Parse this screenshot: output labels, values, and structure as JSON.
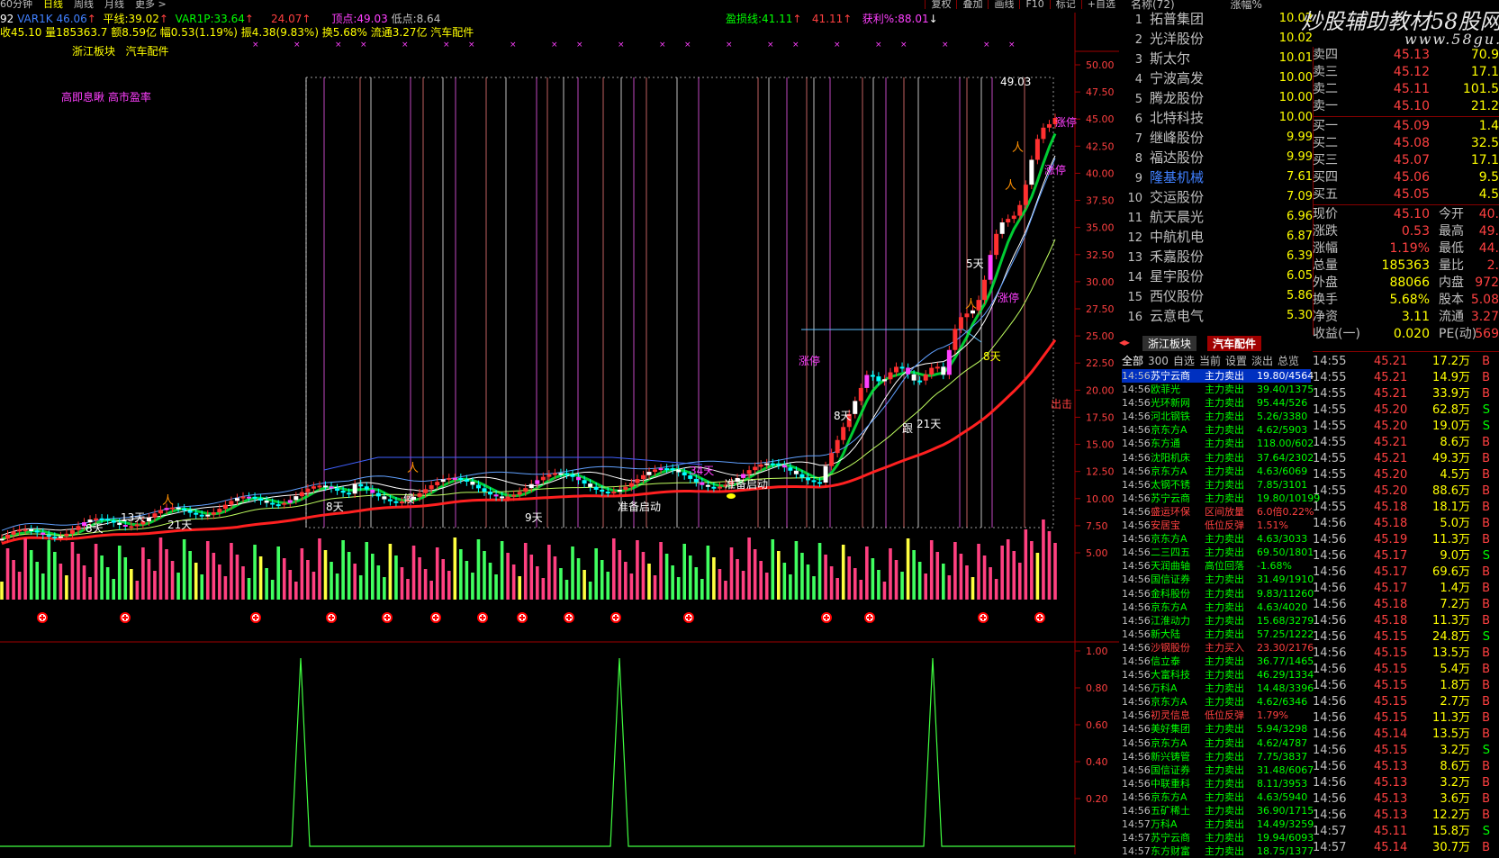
{
  "topbar": {
    "periods": [
      "60分钟",
      "日线",
      "周线",
      "月线",
      "更多 >"
    ],
    "tools": [
      "复权",
      "叠加",
      "画线",
      "F10",
      "标记",
      "+自选"
    ]
  },
  "indicator_row1": {
    "a": "92",
    "var1k_label": "VAR1K",
    "var1k": "46.06",
    "pingxian_label": "平线:",
    "pingxian": "39.02",
    "var1p_label": "VAR1P:",
    "var1p": "33.64",
    "v24": "24.07",
    "dingdian_label": "顶点:",
    "dingdian": "49.03",
    "didian_label": "低点:",
    "didian": "8.64",
    "yingsunxian_label": "盈损线:",
    "yingsunxian": "41.11",
    "v41": "41.11",
    "huoli_label": "获利%:",
    "huoli": "88.01"
  },
  "indicator_row2": "收45.10 量185363.7 额8.59亿 幅0.53(1.19%) 振4.38(9.83%) 换5.68% 流通3.27亿 汽车配件",
  "sector_tags": [
    "浙江板块",
    "汽车配件"
  ],
  "chart_note": "高即息瞅 高市盈率",
  "chart_labels": {
    "peak": "49.03",
    "zhangting": "涨停",
    "chuji": "出击",
    "zhunbei": "准备启动",
    "zhunbei2": "准备启动",
    "d8": "8天",
    "d21": "21天",
    "d5": "5天",
    "d9": "9天",
    "d13": "13天",
    "d34": "34天",
    "gen": "跟",
    "hou": "候"
  },
  "price_axis": [
    "50.00",
    "47.50",
    "45.00",
    "42.50",
    "40.00",
    "37.50",
    "35.00",
    "32.50",
    "30.00",
    "27.50",
    "25.00",
    "22.50",
    "20.00",
    "17.50",
    "15.00",
    "12.50",
    "10.00",
    "7.50",
    "5.00"
  ],
  "sub_axis": [
    "1.00",
    "0.80",
    "0.60",
    "0.40",
    "0.20"
  ],
  "stocklist": {
    "header_name": "名称(72)",
    "header_pct": "涨幅%",
    "items": [
      {
        "n": "1",
        "name": "拓普集团",
        "pct": "10.02"
      },
      {
        "n": "2",
        "name": "光洋股份",
        "pct": "10.02"
      },
      {
        "n": "3",
        "name": "斯太尔",
        "pct": "10.01"
      },
      {
        "n": "4",
        "name": "宁波高发",
        "pct": "10.00"
      },
      {
        "n": "5",
        "name": "腾龙股份",
        "pct": "10.00"
      },
      {
        "n": "6",
        "name": "北特科技",
        "pct": "10.00"
      },
      {
        "n": "7",
        "name": "继峰股份",
        "pct": "9.99"
      },
      {
        "n": "8",
        "name": "福达股份",
        "pct": "9.99"
      },
      {
        "n": "9",
        "name": "隆基机械",
        "pct": "7.61"
      },
      {
        "n": "10",
        "name": "交运股份",
        "pct": "7.09"
      },
      {
        "n": "11",
        "name": "航天晨光",
        "pct": "6.96"
      },
      {
        "n": "12",
        "name": "中航机电",
        "pct": "6.87"
      },
      {
        "n": "13",
        "name": "禾嘉股份",
        "pct": "6.39"
      },
      {
        "n": "14",
        "name": "星宇股份",
        "pct": "6.05"
      },
      {
        "n": "15",
        "name": "西仪股份",
        "pct": "5.86"
      },
      {
        "n": "16",
        "name": "云意电气",
        "pct": "5.30"
      }
    ]
  },
  "watermark": "炒股辅助教材58股网",
  "watermark_url": "www.58gu.com",
  "orderbook": [
    {
      "l": "卖四",
      "p": "45.13",
      "v": "70.9"
    },
    {
      "l": "卖三",
      "p": "45.12",
      "v": "17.1"
    },
    {
      "l": "卖二",
      "p": "45.11",
      "v": "101.5"
    },
    {
      "l": "卖一",
      "p": "45.10",
      "v": "21.2"
    },
    {
      "l": "买一",
      "p": "45.09",
      "v": "1.4"
    },
    {
      "l": "买二",
      "p": "45.08",
      "v": "32.5"
    },
    {
      "l": "买三",
      "p": "45.07",
      "v": "17.1"
    },
    {
      "l": "买四",
      "p": "45.06",
      "v": "9.5"
    },
    {
      "l": "买五",
      "p": "45.05",
      "v": "4.5"
    }
  ],
  "stats": [
    {
      "l": "现价",
      "v": "45.10",
      "l2": "今开",
      "v2": "40."
    },
    {
      "l": "涨跌",
      "v": "0.53",
      "l2": "最高",
      "v2": "49."
    },
    {
      "l": "涨幅",
      "v": "1.19%",
      "l2": "最低",
      "v2": "44."
    },
    {
      "l": "总量",
      "v": "185363",
      "l2": "量比",
      "v2": "2."
    },
    {
      "l": "外盘",
      "v": "88066",
      "l2": "内盘",
      "v2": "972"
    },
    {
      "l": "换手",
      "v": "5.68%",
      "l2": "股本",
      "v2": "5.08"
    },
    {
      "l": "净资",
      "v": "3.11",
      "l2": "流通",
      "v2": "3.27"
    },
    {
      "l": "收益(一)",
      "v": "0.020",
      "l2": "PE(动)",
      "v2": "569"
    }
  ],
  "tabs": [
    "浙江板块",
    "汽车配件"
  ],
  "subtabs": [
    "全部",
    "300",
    "自选",
    "当前",
    "设置",
    "淡出",
    "总览"
  ],
  "ticker": [
    {
      "t": "14:56",
      "name": "苏宁云商",
      "act": "主力卖出",
      "d": "19.80/4564",
      "sel": true
    },
    {
      "t": "14:56",
      "name": "欧菲光",
      "act": "主力卖出",
      "d": "39.40/1375"
    },
    {
      "t": "14:56",
      "name": "光环新网",
      "act": "主力卖出",
      "d": "95.44/526"
    },
    {
      "t": "14:56",
      "name": "河北钢铁",
      "act": "主力卖出",
      "d": "5.26/3380"
    },
    {
      "t": "14:56",
      "name": "京东方A",
      "act": "主力卖出",
      "d": "4.62/5903"
    },
    {
      "t": "14:56",
      "name": "东方通",
      "act": "主力卖出",
      "d": "118.00/602"
    },
    {
      "t": "14:56",
      "name": "沈阳机床",
      "act": "主力卖出",
      "d": "37.64/2302"
    },
    {
      "t": "14:56",
      "name": "京东方A",
      "act": "主力卖出",
      "d": "4.63/6069"
    },
    {
      "t": "14:56",
      "name": "太钢不锈",
      "act": "主力卖出",
      "d": "7.85/3101"
    },
    {
      "t": "14:56",
      "name": "苏宁云商",
      "act": "主力卖出",
      "d": "19.80/10199"
    },
    {
      "t": "14:56",
      "name": "盛运环保",
      "act": "区间放量",
      "d": "6.0倍0.22%"
    },
    {
      "t": "14:56",
      "name": "安居宝",
      "act": "低位反弹",
      "d": "1.51%"
    },
    {
      "t": "14:56",
      "name": "京东方A",
      "act": "主力卖出",
      "d": "4.63/3033"
    },
    {
      "t": "14:56",
      "name": "二三四五",
      "act": "主力卖出",
      "d": "69.50/1801"
    },
    {
      "t": "14:56",
      "name": "天润曲轴",
      "act": "高位回落",
      "d": "-1.68%"
    },
    {
      "t": "14:56",
      "name": "国信证券",
      "act": "主力卖出",
      "d": "31.49/1910"
    },
    {
      "t": "14:56",
      "name": "金科股份",
      "act": "主力卖出",
      "d": "9.83/11260"
    },
    {
      "t": "14:56",
      "name": "京东方A",
      "act": "主力卖出",
      "d": "4.63/4020"
    },
    {
      "t": "14:56",
      "name": "江淮动力",
      "act": "主力卖出",
      "d": "15.68/3279"
    },
    {
      "t": "14:56",
      "name": "新大陆",
      "act": "主力卖出",
      "d": "57.25/1222"
    },
    {
      "t": "14:56",
      "name": "沙钢股份",
      "act": "主力买入",
      "d": "23.30/2176"
    },
    {
      "t": "14:56",
      "name": "信立泰",
      "act": "主力卖出",
      "d": "36.77/1465"
    },
    {
      "t": "14:56",
      "name": "大富科技",
      "act": "主力卖出",
      "d": "46.29/1334"
    },
    {
      "t": "14:56",
      "name": "万科A",
      "act": "主力卖出",
      "d": "14.48/3396"
    },
    {
      "t": "14:56",
      "name": "京东方A",
      "act": "主力卖出",
      "d": "4.62/6346"
    },
    {
      "t": "14:56",
      "name": "初灵信息",
      "act": "低位反弹",
      "d": "1.79%"
    },
    {
      "t": "14:56",
      "name": "美好集团",
      "act": "主力卖出",
      "d": "5.94/3298"
    },
    {
      "t": "14:56",
      "name": "京东方A",
      "act": "主力卖出",
      "d": "4.62/4787"
    },
    {
      "t": "14:56",
      "name": "新兴铸管",
      "act": "主力卖出",
      "d": "7.75/3837"
    },
    {
      "t": "14:56",
      "name": "国信证券",
      "act": "主力卖出",
      "d": "31.48/6067"
    },
    {
      "t": "14:56",
      "name": "中联重科",
      "act": "主力卖出",
      "d": "8.11/3953"
    },
    {
      "t": "14:56",
      "name": "京东方A",
      "act": "主力卖出",
      "d": "4.63/5940"
    },
    {
      "t": "14:56",
      "name": "五矿稀土",
      "act": "主力卖出",
      "d": "36.90/1715"
    },
    {
      "t": "14:57",
      "name": "万科A",
      "act": "主力卖出",
      "d": "14.49/3259"
    },
    {
      "t": "14:57",
      "name": "苏宁云商",
      "act": "主力卖出",
      "d": "19.94/6093"
    },
    {
      "t": "14:57",
      "name": "东方财富",
      "act": "主力卖出",
      "d": "18.75/1377"
    }
  ],
  "trades": [
    {
      "t": "14:55",
      "p": "45.21",
      "v": "17.2万",
      "bs": "B"
    },
    {
      "t": "14:55",
      "p": "45.21",
      "v": "14.9万",
      "bs": "B"
    },
    {
      "t": "14:55",
      "p": "45.21",
      "v": "33.9万",
      "bs": "B"
    },
    {
      "t": "14:55",
      "p": "45.20",
      "v": "62.8万",
      "bs": "S"
    },
    {
      "t": "14:55",
      "p": "45.20",
      "v": "19.0万",
      "bs": "S"
    },
    {
      "t": "14:55",
      "p": "45.21",
      "v": "8.6万",
      "bs": "B"
    },
    {
      "t": "14:55",
      "p": "45.21",
      "v": "49.3万",
      "bs": "B"
    },
    {
      "t": "14:55",
      "p": "45.20",
      "v": "4.5万",
      "bs": "B"
    },
    {
      "t": "14:55",
      "p": "45.20",
      "v": "88.6万",
      "bs": "B"
    },
    {
      "t": "14:55",
      "p": "45.18",
      "v": "18.1万",
      "bs": "B"
    },
    {
      "t": "14:56",
      "p": "45.18",
      "v": "5.0万",
      "bs": "B"
    },
    {
      "t": "14:56",
      "p": "45.19",
      "v": "11.3万",
      "bs": "B"
    },
    {
      "t": "14:56",
      "p": "45.17",
      "v": "9.0万",
      "bs": "S"
    },
    {
      "t": "14:56",
      "p": "45.17",
      "v": "69.6万",
      "bs": "B"
    },
    {
      "t": "14:56",
      "p": "45.17",
      "v": "1.4万",
      "bs": "B"
    },
    {
      "t": "14:56",
      "p": "45.18",
      "v": "7.2万",
      "bs": "B"
    },
    {
      "t": "14:56",
      "p": "45.18",
      "v": "11.3万",
      "bs": "B"
    },
    {
      "t": "14:56",
      "p": "45.15",
      "v": "24.8万",
      "bs": "S"
    },
    {
      "t": "14:56",
      "p": "45.15",
      "v": "13.5万",
      "bs": "B"
    },
    {
      "t": "14:56",
      "p": "45.15",
      "v": "5.4万",
      "bs": "B"
    },
    {
      "t": "14:56",
      "p": "45.15",
      "v": "1.8万",
      "bs": "B"
    },
    {
      "t": "14:56",
      "p": "45.15",
      "v": "2.7万",
      "bs": "B"
    },
    {
      "t": "14:56",
      "p": "45.15",
      "v": "11.3万",
      "bs": "B"
    },
    {
      "t": "14:56",
      "p": "45.14",
      "v": "13.5万",
      "bs": "B"
    },
    {
      "t": "14:56",
      "p": "45.15",
      "v": "3.2万",
      "bs": "S"
    },
    {
      "t": "14:56",
      "p": "45.13",
      "v": "8.6万",
      "bs": "B"
    },
    {
      "t": "14:56",
      "p": "45.13",
      "v": "3.2万",
      "bs": "B"
    },
    {
      "t": "14:56",
      "p": "45.13",
      "v": "3.6万",
      "bs": "B"
    },
    {
      "t": "14:56",
      "p": "45.13",
      "v": "12.2万",
      "bs": "B"
    },
    {
      "t": "14:57",
      "p": "45.11",
      "v": "15.8万",
      "bs": "S"
    },
    {
      "t": "14:57",
      "p": "45.14",
      "v": "30.7万",
      "bs": "B"
    }
  ]
}
